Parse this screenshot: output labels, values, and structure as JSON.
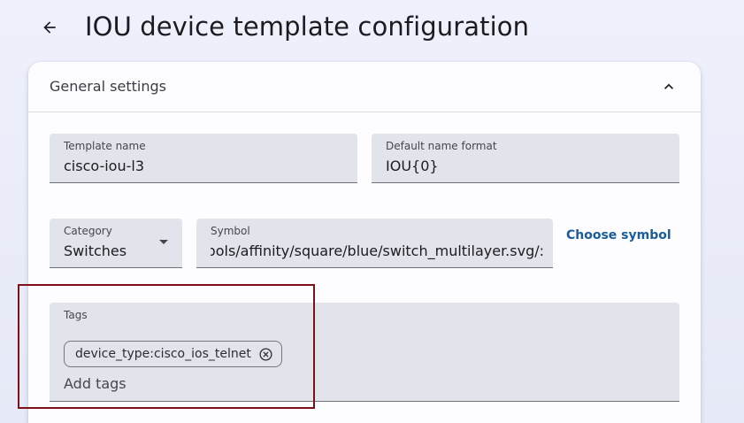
{
  "header": {
    "back_icon": "arrow-left-icon",
    "title": "IOU device template configuration"
  },
  "panel": {
    "title": "General settings",
    "collapse_icon": "chevron-up-icon",
    "expanded": true
  },
  "fields": {
    "template_name": {
      "label": "Template name",
      "value": "cisco-iou-l3"
    },
    "default_name_format": {
      "label": "Default name format",
      "value": "IOU{0}"
    },
    "category": {
      "label": "Category",
      "value": "Switches"
    },
    "symbol": {
      "label": "Symbol",
      "value": ":/symbols/affinity/square/blue/switch_multilayer.svg"
    },
    "choose_symbol_label": "Choose symbol"
  },
  "tags": {
    "label": "Tags",
    "chips": [
      {
        "label": "device_type:cisco_ios_telnet",
        "remove_icon": "cancel-circle-icon"
      }
    ],
    "input_placeholder": "Add tags"
  },
  "colors": {
    "accent": "#1a5c9a",
    "field_background": "#e2e4ec",
    "highlight": "#7a1218"
  }
}
